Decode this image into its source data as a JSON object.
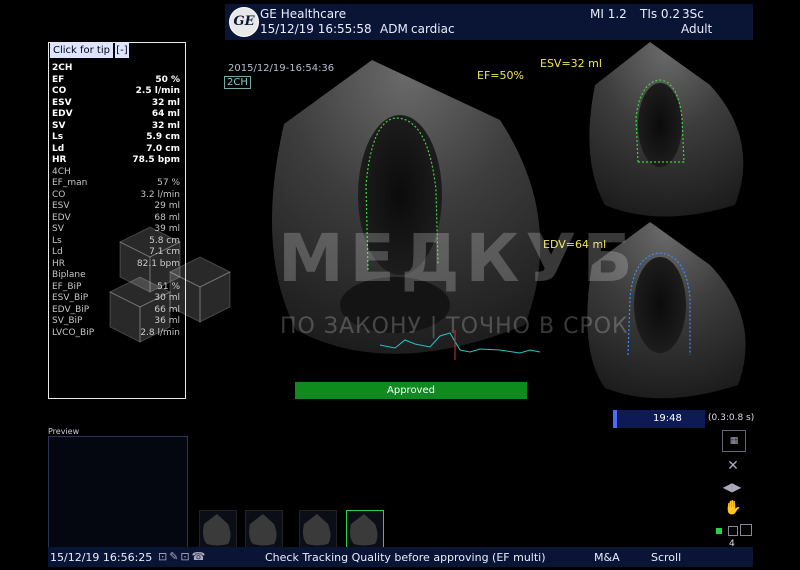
{
  "header": {
    "brand": "GE Healthcare",
    "datetime": "15/12/19 16:55:58",
    "operator": "ADM",
    "preset": "cardiac",
    "mi": "MI 1.2",
    "tis": "TIs 0.2",
    "probe": "3Sc",
    "patient_type": "Adult"
  },
  "panel": {
    "tip_label": "Click for tip",
    "collapse_label": "[-]",
    "sections": [
      {
        "title": "2CH",
        "rows": [
          {
            "label": "EF",
            "value": "50 %"
          },
          {
            "label": "CO",
            "value": "2.5 l/min"
          },
          {
            "label": "ESV",
            "value": "32 ml"
          },
          {
            "label": "EDV",
            "value": "64 ml"
          },
          {
            "label": "SV",
            "value": "32 ml"
          },
          {
            "label": "Ls",
            "value": "5.9 cm"
          },
          {
            "label": "Ld",
            "value": "7.0 cm"
          },
          {
            "label": "HR",
            "value": "78.5 bpm"
          }
        ]
      },
      {
        "title": "4CH",
        "rows": [
          {
            "label": "EF_man",
            "value": "57 %"
          },
          {
            "label": "CO",
            "value": "3.2 l/min"
          },
          {
            "label": "ESV",
            "value": "29 ml"
          },
          {
            "label": "EDV",
            "value": "68 ml"
          },
          {
            "label": "SV",
            "value": "39 ml"
          },
          {
            "label": "Ls",
            "value": "5.8 cm"
          },
          {
            "label": "Ld",
            "value": "7.1 cm"
          },
          {
            "label": "HR",
            "value": "82.1 bpm"
          }
        ]
      },
      {
        "title": "Biplane",
        "rows": [
          {
            "label": "EF_BiP",
            "value": "51 %"
          },
          {
            "label": "ESV_BiP",
            "value": "30 ml"
          },
          {
            "label": "EDV_BiP",
            "value": "66 ml"
          },
          {
            "label": "SV_BiP",
            "value": "36 ml"
          },
          {
            "label": "LVCO_BiP",
            "value": "2.8 l/min"
          }
        ]
      }
    ]
  },
  "image": {
    "timestamp": "2015/12/19-16:54:36",
    "view_label": "2CH",
    "ef_label": "EF=50%",
    "esv_label": "ESV=32 ml",
    "edv_label": "EDV=64 ml",
    "approved_label": "Approved"
  },
  "timer": {
    "time": "19:48",
    "range": "(0.3:0.8 s)"
  },
  "preview": {
    "label": "Preview"
  },
  "footer": {
    "datetime": "15/12/19 16:56:25",
    "status": "Check Tracking Quality before approving (EF multi)",
    "ma_label": "M&A",
    "scroll_label": "Scroll",
    "page_num": "4"
  },
  "watermark": {
    "main": "МЕДКУБ",
    "sub": "ПО ЗАКОНУ | ТОЧНО В СРОК"
  }
}
